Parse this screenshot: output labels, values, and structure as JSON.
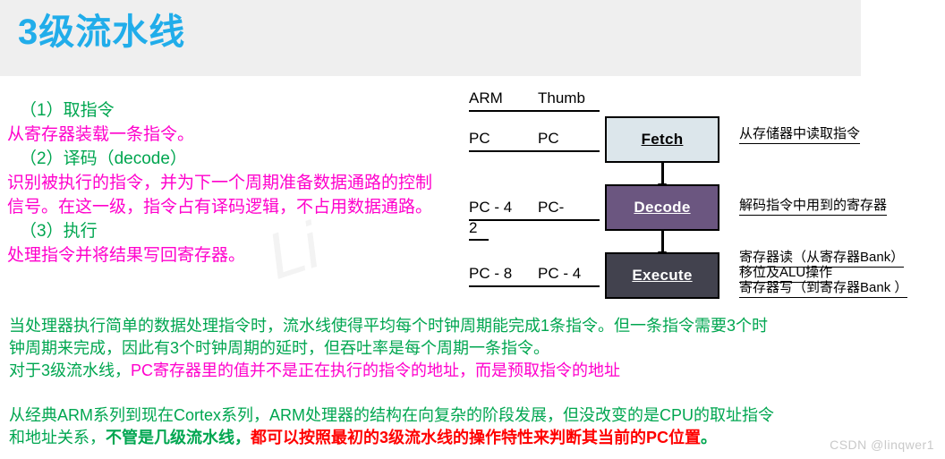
{
  "header": {
    "title": "3级流水线",
    "title_color": "#21ADEA",
    "band_color": "#efefef"
  },
  "steps": [
    {
      "head": "（1）取指令",
      "body": "从寄存器装载一条指令。"
    },
    {
      "head": "（2）译码（decode）",
      "body1": "识别被执行的指令，并为下一个周期准备数据通路的控制",
      "body2": "信号。在这一级，指令占有译码逻辑，不占用数据通路。"
    },
    {
      "head": "（3）执行",
      "body": "处理指令并将结果写回寄存器。"
    }
  ],
  "colors": {
    "step_head": "#00A650",
    "step_body": "#FF00CC",
    "fetch_fill": "#DCE6EB",
    "decode_fill": "#6B5680",
    "execute_fill": "#42424E",
    "emphasis_red": "#FF0000",
    "emphasis_green": "#00A650"
  },
  "pc_table": {
    "col1_header": "ARM",
    "col2_header": "Thumb",
    "rows": [
      {
        "col1": "PC",
        "col2": "PC"
      },
      {
        "col1": "PC - 4",
        "col2": "PC-",
        "col2_wrap": "2"
      },
      {
        "col1": "PC - 8",
        "col2": "PC - 4"
      }
    ]
  },
  "pipeline": {
    "stages": [
      {
        "label": "Fetch",
        "note": "从存储器中读取指令"
      },
      {
        "label": "Decode",
        "note": "解码指令中用到的寄存器"
      },
      {
        "label": "Execute",
        "note_lines": [
          "寄存器读（从寄存器Bank）",
          "移位及ALU操作",
          "寄存器写（到寄存器Bank ）"
        ]
      }
    ]
  },
  "paragraphs": {
    "p1_line1_a": "当处理器执行简单的数据处理指令时，流水线使得平均每个时钟周期能完成1条指令。但一条指令需要3个时",
    "p1_line2_a": "钟周期来完成，因此有3个时钟周期的延时，但吞吐率是每个周期一条指令。",
    "p1_line3_a": "对于3级流水线，",
    "p1_line3_b": "PC寄存器里的值并不是正在执行的指令的地址，而是预取指令的地址",
    "p2_line1": "从经典ARM系列到现在Cortex系列，ARM处理器的结构在向复杂的阶段发展，但没改变的是CPU的取址指令",
    "p2_line2_a": "和地址关系，",
    "p2_line2_b": "不管是几级流水线，",
    "p2_line2_c": "都可以按照最初的3级流水线的操作特性来判断其当前的PC位置",
    "p2_line2_d": "。"
  },
  "watermarks": {
    "csdn": "CSDN @linqwer1",
    "ghost": "Li"
  }
}
